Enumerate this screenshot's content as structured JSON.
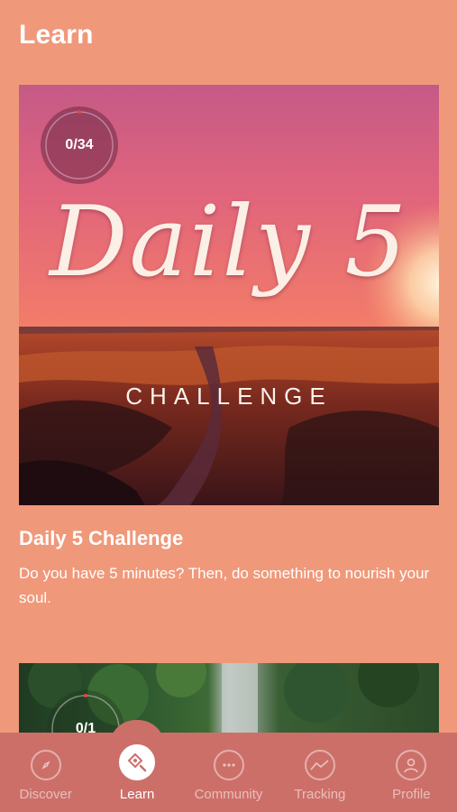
{
  "header": {
    "title": "Learn"
  },
  "cards": [
    {
      "progress": "0/34",
      "progress_fraction": 0.0,
      "cover_script": "Daily 5",
      "cover_subtitle": "CHALLENGE",
      "title": "Daily 5 Challenge",
      "description": "Do you have 5 minutes? Then, do something to nourish your soul."
    },
    {
      "progress": "0/1",
      "progress_fraction": 0.0
    }
  ],
  "tabs": [
    {
      "label": "Discover",
      "icon": "compass-icon",
      "active": false
    },
    {
      "label": "Learn",
      "icon": "learn-icon",
      "active": true
    },
    {
      "label": "Community",
      "icon": "chat-bubble-icon",
      "active": false
    },
    {
      "label": "Tracking",
      "icon": "chart-icon",
      "active": false
    },
    {
      "label": "Profile",
      "icon": "user-icon",
      "active": false
    }
  ],
  "colors": {
    "background": "#F0987A",
    "tabbar": "#CD6F69",
    "text": "#FFFFFF"
  }
}
